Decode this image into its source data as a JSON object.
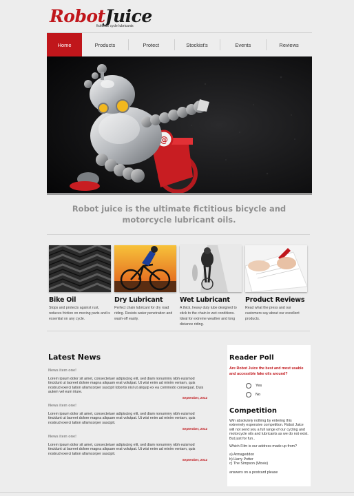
{
  "brand": {
    "logo_part1": "Robot",
    "logo_part2": "Juice",
    "tagline": "fictitious cycle lubricants"
  },
  "nav": {
    "items": [
      {
        "label": "Home",
        "active": true
      },
      {
        "label": "Products"
      },
      {
        "label": "Protect"
      },
      {
        "label": "Stockist's"
      },
      {
        "label": "Events"
      },
      {
        "label": "Reviews"
      }
    ]
  },
  "hero": {
    "tagline": "Robot juice is the ultimate fictitious bicycle and motorcycle lubricant oils."
  },
  "products": [
    {
      "name": "Bike Oil",
      "desc": "Stops and protects against rust, reduces friction on moving parts and is essential on any cycle."
    },
    {
      "name": "Dry Lubricant",
      "desc": "Perfect chain lubricant for dry road riding. Resists water penetration and wash-off easily."
    },
    {
      "name": "Wet Lubricant",
      "desc": "A thick, heavy duty lube designed to stick to the chain in wet conditions. Ideal for extreme weather and long distance riding."
    },
    {
      "name": "Product Reviews",
      "desc": "Read what the press and our customers say about our excellent products."
    }
  ],
  "news": {
    "title": "Latest News",
    "items": [
      {
        "heading": "News item one!",
        "body": "Lorem ipsum dolor sit amet, consectetuer adipiscing elit, sed diam nonummy nibh euismod tincidunt ut laoreet dolore magna aliquam erat volutpat. Ut wisi enim ad minim veniam, quis nostrud exerci tation ullamcorper suscipit lobortis nisl ut aliquip ex ea commodo consequat. Duis autem vel eum iriure.",
        "date": "September, 2012"
      },
      {
        "heading": "News item one!",
        "body": "Lorem ipsum dolor sit amet, consectetuer adipiscing elit, sed diam nonummy nibh euismod tincidunt ut laoreet dolore magna aliquam erat volutpat. Ut wisi enim ad minim veniam, quis nostrud exerci tation ullamcorper suscipit.",
        "date": "September, 2012"
      },
      {
        "heading": "News item one!",
        "body": "Lorem ipsum dolor sit amet, consectetuer adipiscing elit, sed diam nonummy nibh euismod tincidunt ut laoreet dolore magna aliquam erat volutpat. Ut wisi enim ad minim veniam, quis nostrud exerci tation ullamcorper suscipit.",
        "date": "September, 2012"
      }
    ]
  },
  "poll": {
    "title": "Reader Poll",
    "question": "Are Robot Juice the best and most usable and accessible fake oils around?",
    "options": [
      "Yes",
      "No"
    ]
  },
  "competition": {
    "title": "Competition",
    "intro": "Win absolutely nothing by entering this extremely expensive competition. Robot Juice will not send you a full range of our cycling and motorcycle oils and lubricants as we do not exist. But just for fun..",
    "question": "Which Film is our address made up from?",
    "answers": [
      "a) Armageddon",
      "b) Harry Potter",
      "c) The Simpson (Movie)"
    ],
    "footer": "answers on a postcard please"
  },
  "colors": {
    "accent": "#c0161b",
    "background": "#ededed"
  }
}
